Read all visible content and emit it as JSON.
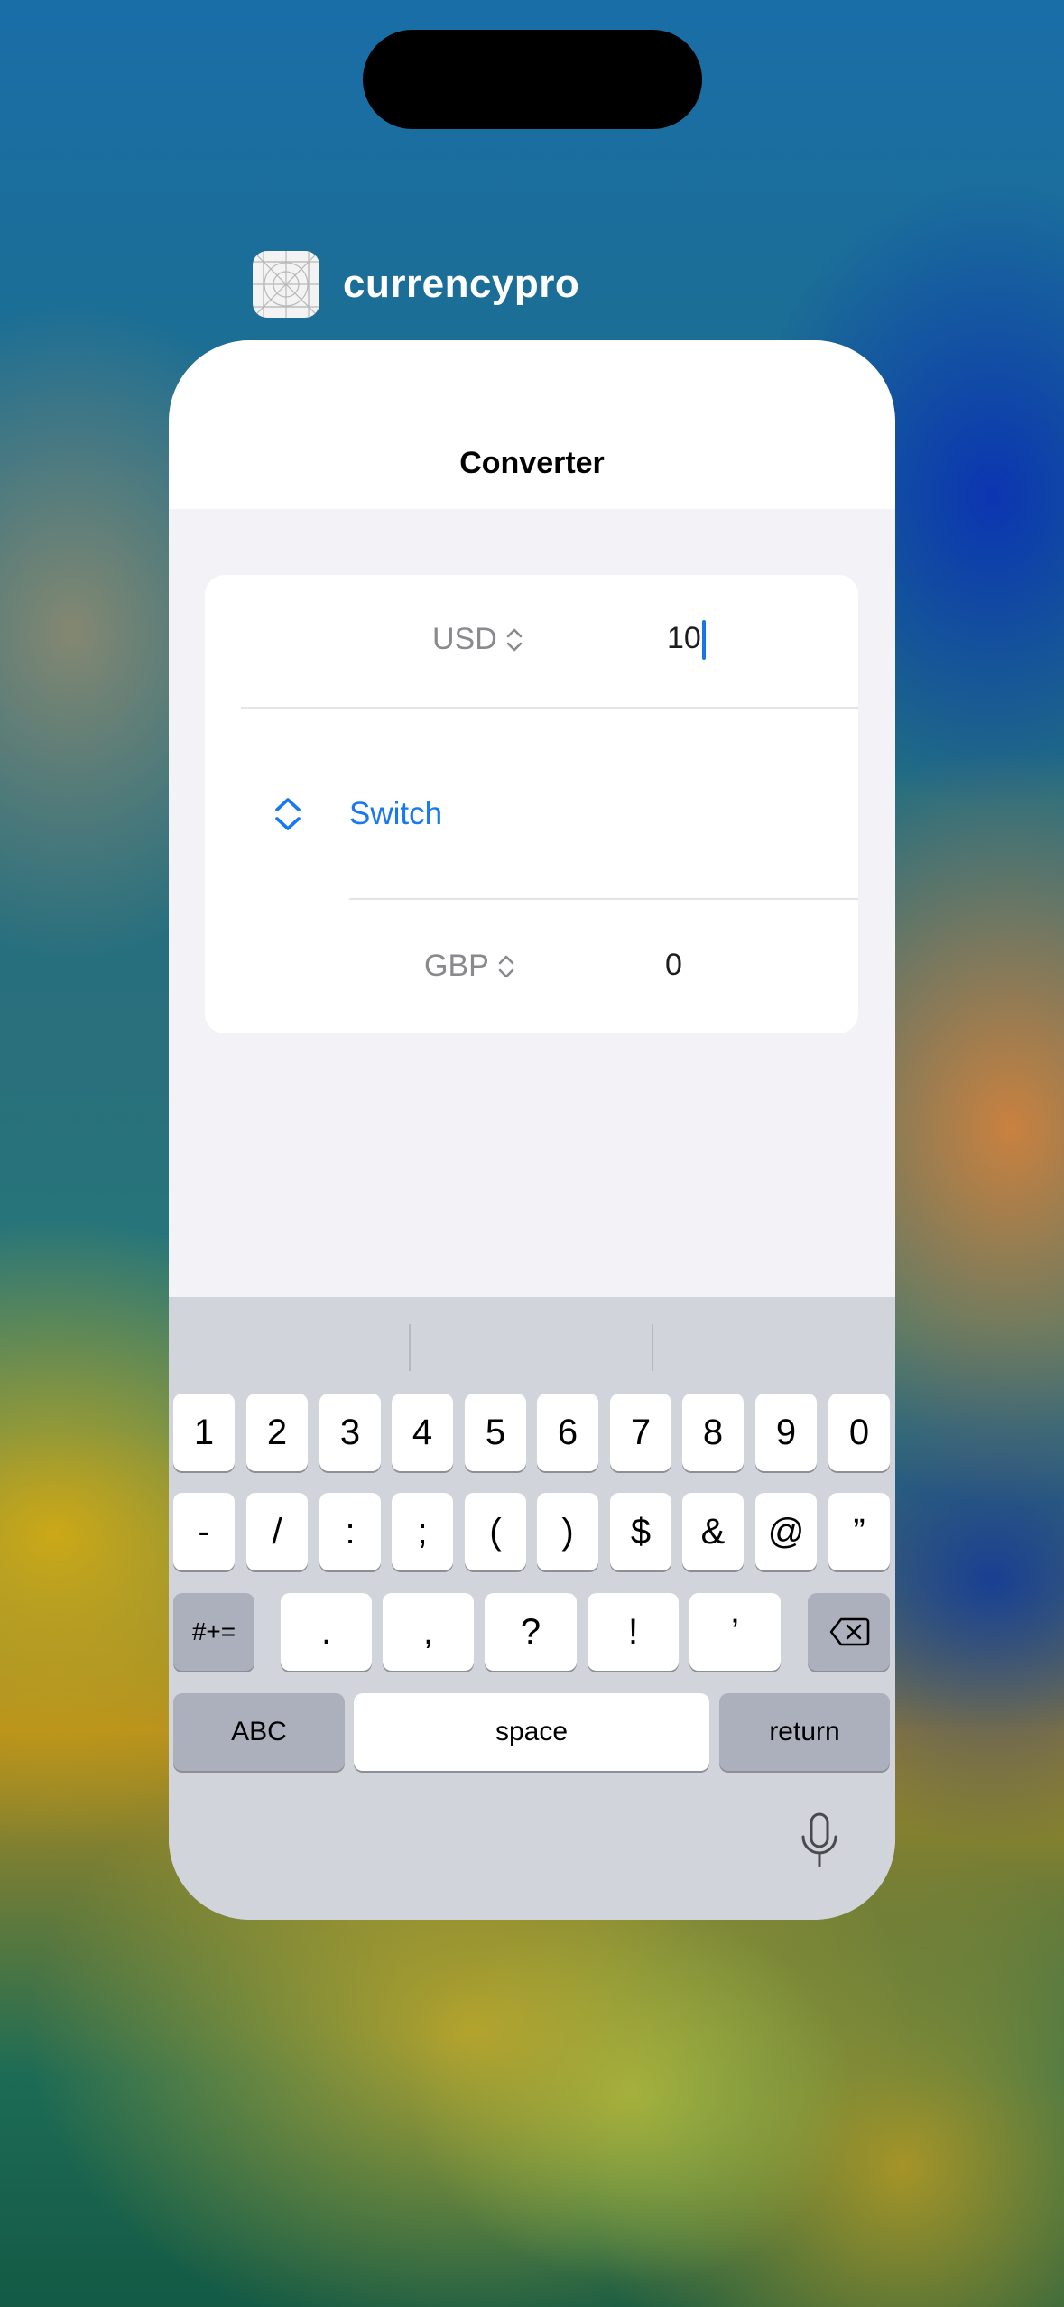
{
  "app": {
    "name": "currencypro"
  },
  "nav": {
    "title": "Converter"
  },
  "converter": {
    "from_currency": "USD",
    "from_amount": "10",
    "switch_label": "Switch",
    "to_currency": "GBP",
    "to_amount": "0"
  },
  "keyboard": {
    "row1": [
      "1",
      "2",
      "3",
      "4",
      "5",
      "6",
      "7",
      "8",
      "9",
      "0"
    ],
    "row2": [
      "-",
      "/",
      ":",
      ";",
      "(",
      ")",
      "$",
      "&",
      "@",
      "”"
    ],
    "row3": [
      ".",
      ",",
      "?",
      "!",
      "’"
    ],
    "more_symbols": "#+=",
    "abc": "ABC",
    "space": "space",
    "return": "return"
  },
  "colors": {
    "accent": "#1877f2",
    "card_bg": "#f2f2f7",
    "keyboard_bg": "#d2d4db"
  }
}
